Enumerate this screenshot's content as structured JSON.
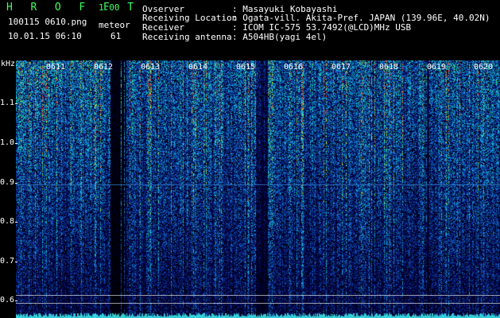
{
  "header": {
    "app_title": "H R O F F T",
    "app_version": "1.00",
    "filename": "100115 0610.png",
    "datetime": "10.01.15 06:10",
    "meteor_label": "meteor",
    "meteor_count": "61"
  },
  "station": {
    "observer_label": "Ovserver",
    "observer_value": ": Masayuki Kobayashi",
    "location_label": "Receiving Location",
    "location_value": ": Ogata-vill. Akita-Pref. JAPAN (139.96E, 40.02N)",
    "receiver_label": "Receiver",
    "receiver_value": ": ICOM IC-575 53.7492(@LCD)MHz USB",
    "antenna_label": "Receiving antenna",
    "antenna_value": ": A504HB(yagi 4el)"
  },
  "spectrogram": {
    "y_unit": "kHz",
    "y_ticks": [
      "1.1",
      "1.0",
      "0.9",
      "0.8",
      "0.7",
      "0.6"
    ],
    "time_labels": [
      "0611",
      "0612",
      "0613",
      "0614",
      "0615",
      "0616",
      "0617",
      "0618",
      "0619",
      "0620"
    ],
    "colors": {
      "background": "#000000",
      "low": "#0a1a6a",
      "mid": "#1f6fd0",
      "high": "#1fd0c0",
      "peak": "#e0e020",
      "hot": "#ff3030",
      "marker_line": "#40ffff"
    }
  }
}
